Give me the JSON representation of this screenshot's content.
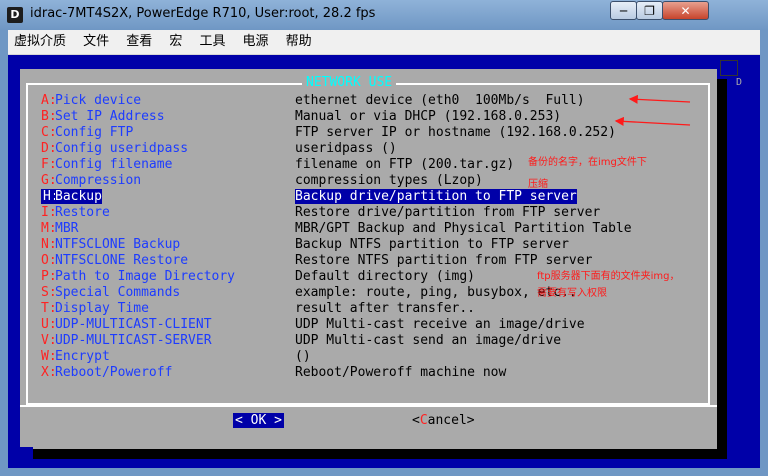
{
  "window": {
    "app_icon": "D",
    "title": "idrac-7MT4S2X, PowerEdge R710, User:root, 28.2 fps",
    "minimize": "─",
    "maximize": "❐",
    "close": "✕"
  },
  "menubar": [
    "虚拟介质",
    "文件",
    "查看",
    "宏",
    "工具",
    "电源",
    "帮助"
  ],
  "dialog": {
    "title": "NETWORK USE",
    "items": [
      {
        "key": "A:",
        "label": "Pick device",
        "desc": "ethernet device (eth0  100Mb/s  Full)"
      },
      {
        "key": "B:",
        "label": "Set IP Address",
        "desc": "Manual or via DHCP (192.168.0.253)"
      },
      {
        "key": "C:",
        "label": "Config FTP",
        "desc": "FTP server IP or hostname (192.168.0.252)"
      },
      {
        "key": "D:",
        "label": "Config useridpass",
        "desc": "useridpass ()"
      },
      {
        "key": "F:",
        "label": "Config filename",
        "desc": "filename on FTP (200.tar.gz)"
      },
      {
        "key": "G:",
        "label": "Compression",
        "desc": "compression types (Lzop)"
      },
      {
        "key": "H:",
        "label": "Backup",
        "desc": "Backup drive/partition to FTP server",
        "selected": true
      },
      {
        "key": "I:",
        "label": "Restore",
        "desc": "Restore drive/partition from FTP server"
      },
      {
        "key": "M:",
        "label": "MBR",
        "desc": "MBR/GPT Backup and Physical Partition Table"
      },
      {
        "key": "N:",
        "label": "NTFSCLONE Backup",
        "desc": "Backup NTFS partition to FTP server"
      },
      {
        "key": "O:",
        "label": "NTFSCLONE Restore",
        "desc": "Restore NTFS partition from FTP server"
      },
      {
        "key": "P:",
        "label": "Path to Image Directory",
        "desc": "Default directory (img)"
      },
      {
        "key": "S:",
        "label": "Special Commands",
        "desc": "example: route, ping, busybox, etc.."
      },
      {
        "key": "T:",
        "label": "Display Time",
        "desc": "result after transfer.."
      },
      {
        "key": "U:",
        "label": "UDP-MULTICAST-CLIENT",
        "desc": "UDP Multi-cast receive an image/drive"
      },
      {
        "key": "V:",
        "label": "UDP-MULTICAST-SERVER",
        "desc": "UDP Multi-cast send an image/drive"
      },
      {
        "key": "W:",
        "label": "Encrypt",
        "desc": "()"
      },
      {
        "key": "X:",
        "label": "Reboot/Poweroff",
        "desc": "Reboot/Poweroff machine now"
      }
    ],
    "ok_label": "<  OK  >",
    "cancel_pre": "<",
    "cancel_hot": "C",
    "cancel_post": "ancel>"
  },
  "annotations": {
    "note1": "备份的名字，在img文件下",
    "note2": "压缩",
    "note3": "ftp服务器下面有的文件夹img，",
    "note4": "需要有写入权限",
    "arrow_color": "#ff1a1a"
  },
  "edge_letter": "D"
}
